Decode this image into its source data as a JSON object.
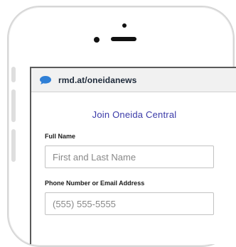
{
  "browser": {
    "url": "rmd.at/oneidanews",
    "icon": "chat-bubble-icon",
    "accent": "#2f7fd6"
  },
  "form": {
    "title": "Join Oneida Central",
    "title_color": "#3a3aa8",
    "fields": [
      {
        "label": "Full Name",
        "placeholder": "First and Last Name",
        "value": ""
      },
      {
        "label": "Phone Number or Email Address",
        "placeholder": "(555) 555-5555",
        "value": ""
      }
    ]
  }
}
